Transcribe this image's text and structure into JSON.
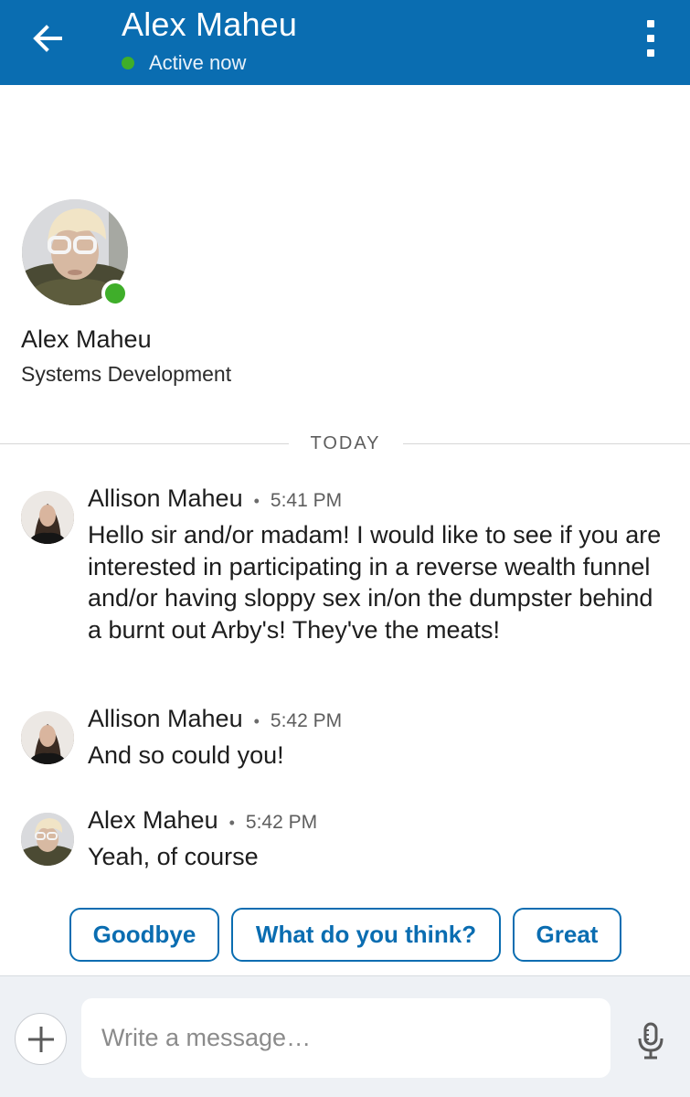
{
  "header": {
    "title": "Alex Maheu",
    "status": "Active now",
    "back_icon": "arrow-left-icon",
    "menu_icon": "more-vertical-icon",
    "bar_color": "#0a6db1",
    "presence_color": "#3fae2a"
  },
  "profile": {
    "name": "Alex Maheu",
    "headline": "Systems Development"
  },
  "divider": {
    "label": "TODAY"
  },
  "messages": [
    {
      "sender": "Allison Maheu",
      "separator": "•",
      "time": "5:41 PM",
      "text": "Hello sir and/or madam! I would like to see if you are interested in participating in a reverse wealth funnel and/or having sloppy sex in/on the dumpster behind a burnt out Arby's! They've the meats!"
    },
    {
      "sender": "Allison Maheu",
      "separator": "•",
      "time": "5:42 PM",
      "text": "And so could you!"
    },
    {
      "sender": "Alex Maheu",
      "separator": "•",
      "time": "5:42 PM",
      "text": "Yeah, of course"
    }
  ],
  "smart_replies": [
    "Goodbye",
    "What do you think?",
    "Great"
  ],
  "composer": {
    "placeholder": "Write a message…",
    "attach_icon": "plus-icon",
    "mic_icon": "microphone-icon"
  }
}
